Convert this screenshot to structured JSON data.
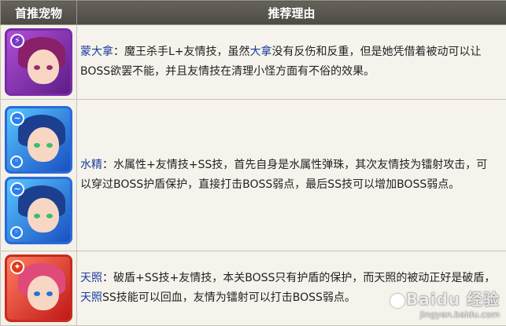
{
  "table": {
    "headers": [
      "首推宠物",
      "推荐理由"
    ],
    "rows": [
      {
        "name": "蒙大拿",
        "parts": [
          "：魔王杀手L+友情技，虽然",
          "大拿",
          "没有反伤和反重，但是她凭借着被动可以让BOSS欲罢不能，并且友情技在清理小怪方面有不俗的效果。"
        ],
        "avatars": [
          {
            "icon": "fire-lightning-badge",
            "color": "purple"
          }
        ]
      },
      {
        "name": "水精",
        "parts": [
          "：水属性+友情技+SS技，首先自身是水属性弹珠，其次友情技为镭射攻击，可以穿过BOSS护盾保护，直接打击BOSS弱点，最后SS技可以增加BOSS弱点。"
        ],
        "avatars": [
          {
            "icon": "water-badge",
            "color": "blue"
          },
          {
            "icon": "water-badge",
            "color": "blue"
          }
        ]
      },
      {
        "name": "天照",
        "parts": [
          "：破盾+SS技+友情技，本关BOSS只有护盾的保护，而天照的被动正好是破盾，",
          "天照",
          "SS技能可以回血，友情为镭射可以打击BOSS弱点。"
        ],
        "avatars": [
          {
            "icon": "fire-badge",
            "color": "red"
          }
        ]
      }
    ]
  },
  "watermark": {
    "brand": "Baidu 经验",
    "url": "jingyan.baidu.com"
  }
}
